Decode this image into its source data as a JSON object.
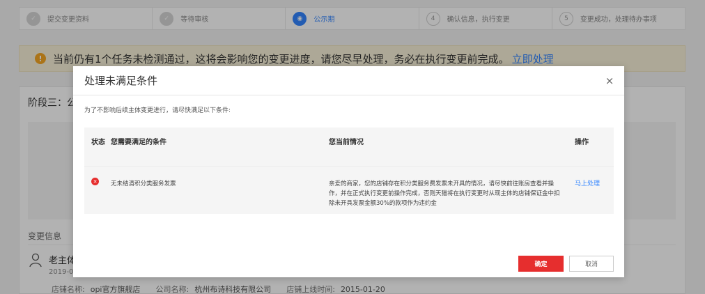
{
  "steps": [
    {
      "index": "✓",
      "label": "提交变更资料",
      "state": "done"
    },
    {
      "index": "✓",
      "label": "等待审核",
      "state": "done"
    },
    {
      "index": "◉",
      "label": "公示期",
      "state": "active"
    },
    {
      "index": "4",
      "label": "确认信息，执行变更",
      "state": "todo"
    },
    {
      "index": "5",
      "label": "变更成功，处理待办事项",
      "state": "todo"
    }
  ],
  "alert": {
    "icon": "warning-icon",
    "text": "当前仍有1个任务未检测通过，这将会影响您的变更进度，请您尽早处理，务必在执行变更前完成。",
    "link": "立即处理"
  },
  "main": {
    "stage_title": "阶段三：公",
    "section_title": "变更信息",
    "owner_name": "老主体",
    "owner_date": "2019-0",
    "store": {
      "store_name_label": "店铺名称:",
      "store_name": "opi官方旗舰店",
      "company_label": "公司名称:",
      "company": "杭州布诗科技有限公司",
      "online_label": "店铺上线时间:",
      "online": "2015-01-20"
    }
  },
  "modal": {
    "title": "处理未满足条件",
    "close": "×",
    "intro": "为了不影响后续主体变更进行，请尽快满足以下条件:",
    "headers": {
      "status": "状态",
      "condition": "您需要满足的条件",
      "current": "您当前情况",
      "action": "操作"
    },
    "rows": [
      {
        "status_icon": "close-circle-icon",
        "condition": "无未结清积分类服务发票",
        "current": "亲爱的商家，您的店铺存在积分类服务费发票未开具的情况，请尽快前往账房查看并操作，并在正式执行变更前操作完成，否则天猫将在执行变更时从现主体的店铺保证金中扣除未开具发票金额30%的款项作为违约金",
        "action": "马上处理"
      }
    ],
    "confirm": "确定",
    "cancel": "取消"
  }
}
